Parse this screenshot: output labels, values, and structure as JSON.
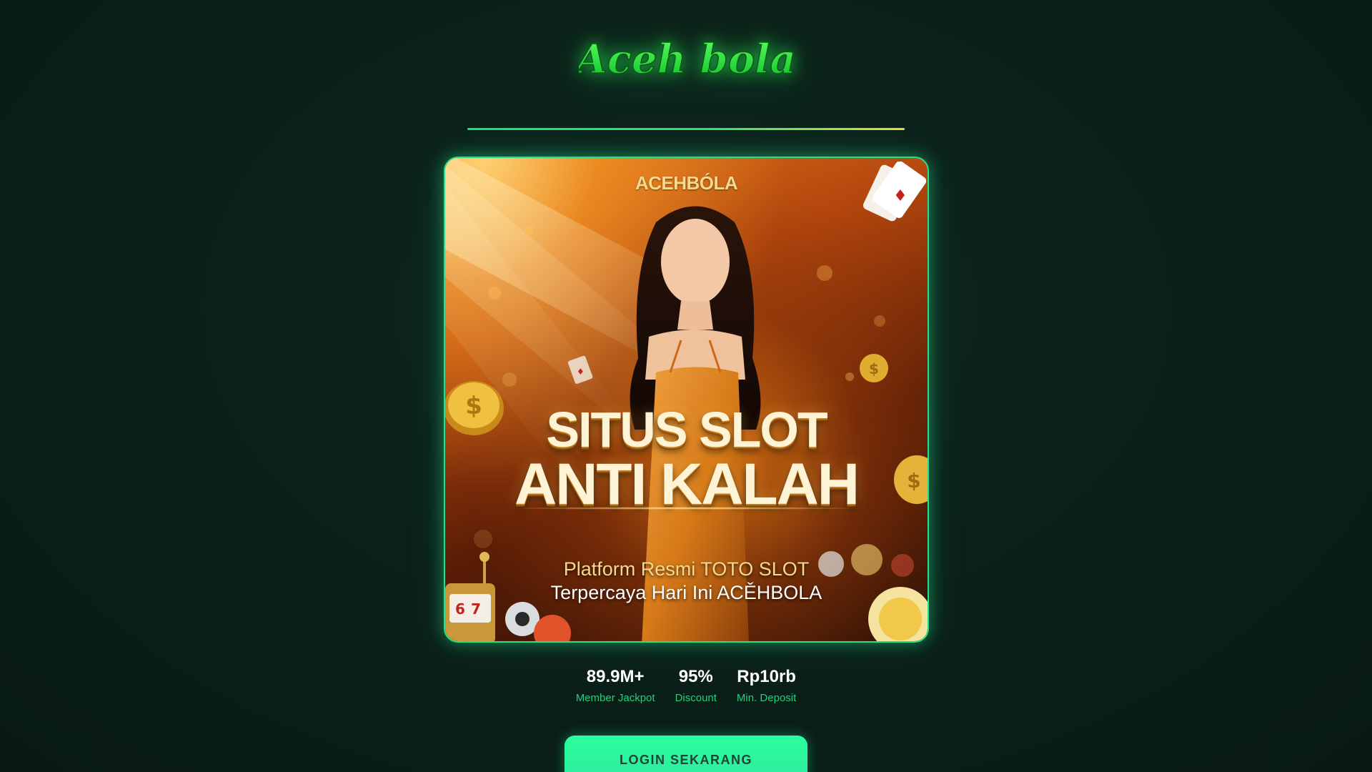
{
  "logo": {
    "text": "Aceh bola",
    "alt": "Aceh Bola logo"
  },
  "banner": {
    "brand": "ACEHBÓLA",
    "title_line1": "SITUS SLOT",
    "title_line2": "ANTI KALAH",
    "subtitle_line1": "Platform Resmi TOTO SLOT",
    "subtitle_line2": "Terpercaya Hari Ini ACĚHBOLA"
  },
  "stats": [
    {
      "value": "89.9M+",
      "label": "Member Jackpot"
    },
    {
      "value": "95%",
      "label": "Discount"
    },
    {
      "value": "Rp10rb",
      "label": "Min. Deposit"
    }
  ],
  "login": {
    "label": "LOGIN SEKARANG"
  },
  "colors": {
    "accent": "#25e08a",
    "stat_label": "#21d07a",
    "button": "#2bffa0",
    "background": "#0b2019"
  }
}
